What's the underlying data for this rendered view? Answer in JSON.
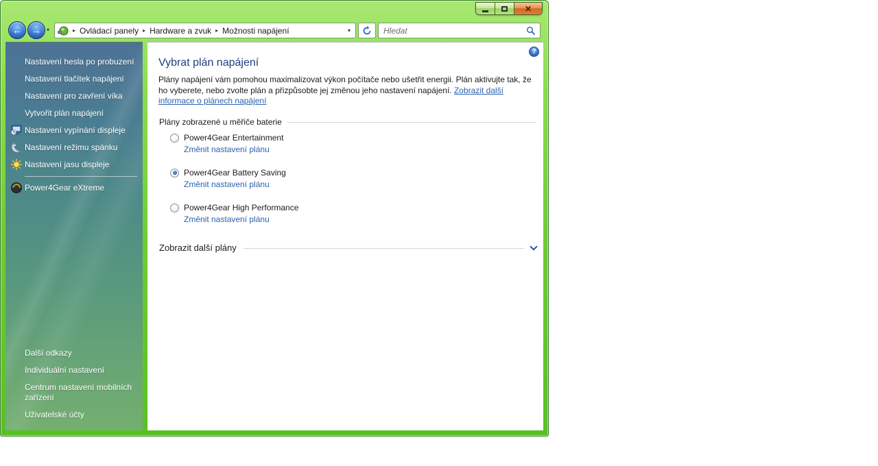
{
  "titlebar": {
    "close_glyph": "✕"
  },
  "navbar": {
    "back_glyph": "←",
    "fwd_glyph": "→",
    "chevron_glyph": "▾",
    "crumb_sep": "▸",
    "crumb_dd": "▾",
    "breadcrumb": [
      "Ovládací panely",
      "Hardware a zvuk",
      "Možnosti napájení"
    ],
    "search_placeholder": "Hledat"
  },
  "sidebar": {
    "items": [
      {
        "label": "Nastavení hesla po probuzení"
      },
      {
        "label": "Nastavení tlačítek napájení"
      },
      {
        "label": "Nastavení pro zavření víka"
      },
      {
        "label": "Vytvořit plán napájení"
      },
      {
        "label": "Nastavení vypínání displeje",
        "icon": "display-clock"
      },
      {
        "label": "Nastavení režimu spánku",
        "icon": "moon"
      },
      {
        "label": "Nastavení jasu displeje",
        "icon": "sun"
      },
      {
        "label": "Power4Gear eXtreme",
        "icon": "power4gear"
      }
    ],
    "footer_header": "Další odkazy",
    "footer_items": [
      {
        "label": "Individuální nastavení"
      },
      {
        "label": "Centrum nastavení mobilních zařízení"
      },
      {
        "label": "Uživatelské účty"
      }
    ]
  },
  "main": {
    "help_glyph": "?",
    "title": "Vybrat plán napájení",
    "intro_text": "Plány napájení vám pomohou maximalizovat výkon počítače nebo ušetřit energii. Plán aktivujte tak, že ho vyberete, nebo zvolte plán a přizpůsobte jej změnou jeho nastavení napájení. ",
    "intro_link": "Zobrazit další informace o plánech napájení",
    "section_header": "Plány zobrazené u měřiče baterie",
    "plans": [
      {
        "name": "Power4Gear Entertainment",
        "selected": false,
        "link": "Změnit nastavení plánu"
      },
      {
        "name": "Power4Gear Battery Saving",
        "selected": true,
        "link": "Změnit nastavení plánu"
      },
      {
        "name": "Power4Gear High Performance",
        "selected": false,
        "link": "Změnit nastavení plánu"
      }
    ],
    "more_plans_label": "Zobrazit další plány"
  },
  "colors": {
    "frame_green": "#6ecb36",
    "sidebar_top": "#4d7295",
    "sidebar_bottom": "#74af70",
    "title_blue": "#1f3b82",
    "link_blue": "#2b62ae",
    "close_orange": "#d2691e"
  }
}
